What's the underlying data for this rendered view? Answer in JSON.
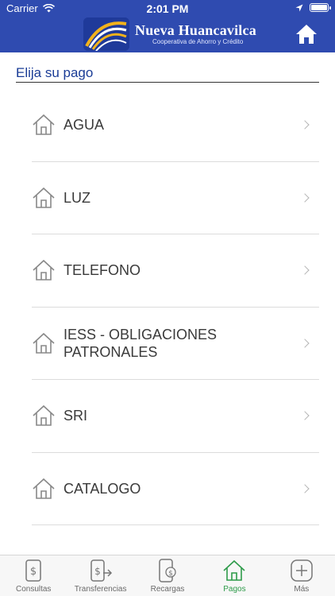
{
  "status_bar": {
    "carrier": "Carrier",
    "time": "2:01 PM"
  },
  "header": {
    "brand_name": "Nueva Huancavilca",
    "brand_subtitle": "Cooperativa de Ahorro y Crédito",
    "home_icon": "home-icon"
  },
  "page": {
    "section_title": "Elija su pago"
  },
  "payments": [
    {
      "label": "AGUA",
      "icon": "house-icon"
    },
    {
      "label": "LUZ",
      "icon": "house-icon"
    },
    {
      "label": "TELEFONO",
      "icon": "house-icon"
    },
    {
      "label": "IESS - OBLIGACIONES PATRONALES",
      "icon": "house-icon"
    },
    {
      "label": "SRI",
      "icon": "house-icon"
    },
    {
      "label": "CATALOGO",
      "icon": "house-icon"
    }
  ],
  "tabbar": {
    "tabs": [
      {
        "label": "Consultas",
        "icon": "dollar-phone-icon"
      },
      {
        "label": "Transferencias",
        "icon": "transfer-icon"
      },
      {
        "label": "Recargas",
        "icon": "mobile-recharge-icon"
      },
      {
        "label": "Pagos",
        "icon": "house-icon",
        "active": true
      },
      {
        "label": "Más",
        "icon": "plus-icon"
      }
    ]
  },
  "colors": {
    "header_bg": "#2f4bb0",
    "title_text": "#1a3c96",
    "active_tab": "#2e9b4a"
  }
}
